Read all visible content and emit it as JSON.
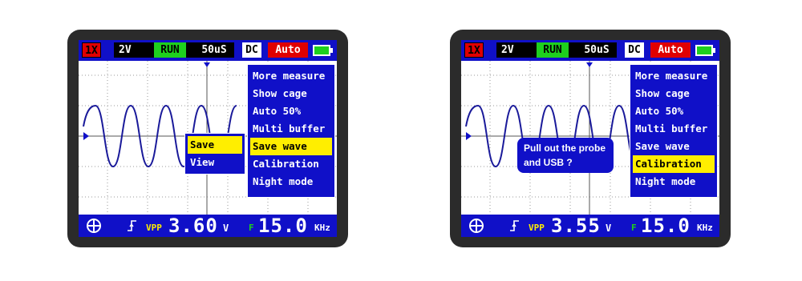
{
  "scopes": [
    {
      "top": {
        "probe": "1X",
        "volt_div": "2V",
        "run_state": "RUN",
        "time_div": "50uS",
        "coupling": "DC",
        "trigger_mode": "Auto"
      },
      "menu": {
        "items": [
          "More measure",
          "Show cage",
          "Auto 50%",
          "Multi buffer",
          "Save wave",
          "Calibration",
          "Night mode"
        ],
        "selected": "Save wave"
      },
      "submenu": {
        "items": [
          "Save",
          "View"
        ],
        "selected": "Save"
      },
      "bottom": {
        "vpp_label": "VPP",
        "vpp_value": "3.60",
        "vpp_unit": "V",
        "freq_label": "F",
        "freq_value": "15.0",
        "freq_unit": "KHz"
      }
    },
    {
      "top": {
        "probe": "1X",
        "volt_div": "2V",
        "run_state": "RUN",
        "time_div": "50uS",
        "coupling": "DC",
        "trigger_mode": "Auto"
      },
      "menu": {
        "items": [
          "More measure",
          "Show cage",
          "Auto 50%",
          "Multi buffer",
          "Save wave",
          "Calibration",
          "Night mode"
        ],
        "selected": "Calibration"
      },
      "dialog": {
        "line1": "Pull out the probe",
        "line2": "and USB ?"
      },
      "bottom": {
        "vpp_label": "VPP",
        "vpp_value": "3.55",
        "vpp_unit": "V",
        "freq_label": "F",
        "freq_value": "15.0",
        "freq_unit": "KHz"
      }
    }
  ],
  "colors": {
    "screen_blue": "#1010c8",
    "highlight": "#ffee00",
    "run_green": "#1ed01e",
    "alert_red": "#e00000",
    "trace": "#1a1a9a"
  },
  "icons": [
    "channel-marker-icon",
    "trigger-marker-icon",
    "battery-icon",
    "crosshair-icon",
    "trigger-edge-icon"
  ]
}
